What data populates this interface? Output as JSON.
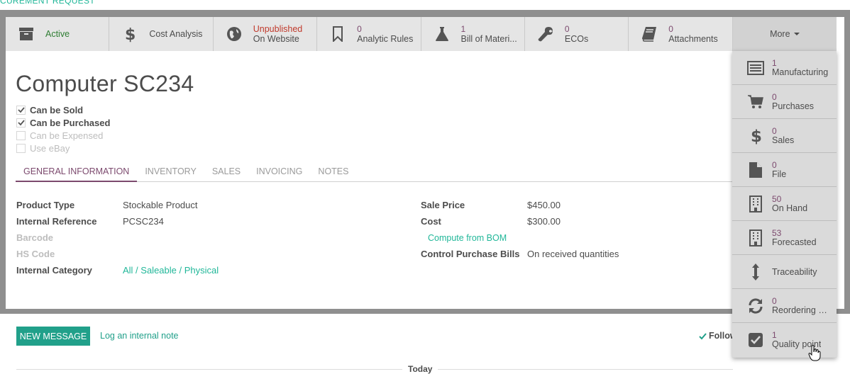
{
  "breadcrumb_fragment": "CUREMENT REQUEST",
  "smart_buttons": [
    {
      "id": "active",
      "icon": "archive-icon",
      "label": "Active"
    },
    {
      "id": "cost-analysis",
      "icon": "dollar-icon",
      "label": "Cost Analysis"
    },
    {
      "id": "website",
      "icon": "globe-icon",
      "top": "Unpublished",
      "label": "On Website"
    },
    {
      "id": "analytic-rules",
      "icon": "bookmark-icon",
      "count": "0",
      "label": "Analytic Rules"
    },
    {
      "id": "bom",
      "icon": "flask-icon",
      "count": "1",
      "label": "Bill of Materi..."
    },
    {
      "id": "ecos",
      "icon": "wrench-icon",
      "count": "0",
      "label": "ECOs"
    },
    {
      "id": "attachments",
      "icon": "book-icon",
      "count": "0",
      "label": "Attachments"
    }
  ],
  "more_label": "More",
  "product": {
    "name": "Computer SC234",
    "options": [
      {
        "label": "Can be Sold",
        "checked": true
      },
      {
        "label": "Can be Purchased",
        "checked": true
      },
      {
        "label": "Can be Expensed",
        "checked": false
      },
      {
        "label": "Use eBay",
        "checked": false
      }
    ]
  },
  "tabs": [
    "GENERAL INFORMATION",
    "INVENTORY",
    "SALES",
    "INVOICING",
    "NOTES"
  ],
  "fields_left": [
    {
      "label": "Product Type",
      "value": "Stockable Product"
    },
    {
      "label": "Internal Reference",
      "value": "PCSC234"
    },
    {
      "label": "Barcode",
      "value": ""
    },
    {
      "label": "HS Code",
      "value": ""
    },
    {
      "label": "Internal Category",
      "value": "All / Saleable / Physical"
    }
  ],
  "fields_right": {
    "sale_price_label": "Sale Price",
    "sale_price": "$450.00",
    "cost_label": "Cost",
    "cost": "$300.00",
    "compute_link": "Compute from BOM",
    "control_label": "Control Purchase Bills",
    "control_value": "On received quantities"
  },
  "chatter": {
    "new_message": "NEW MESSAGE",
    "log_note": "Log an internal note",
    "follow": "Follow",
    "today": "Today"
  },
  "dropdown_items": [
    {
      "icon": "list-icon",
      "count": "1",
      "label": "Manufacturing"
    },
    {
      "icon": "cart-icon",
      "count": "0",
      "label": "Purchases"
    },
    {
      "icon": "dollar-icon",
      "count": "0",
      "label": "Sales"
    },
    {
      "icon": "file-icon",
      "count": "0",
      "label": "File"
    },
    {
      "icon": "building-icon",
      "count": "50",
      "label": "On Hand"
    },
    {
      "icon": "building-icon",
      "count": "53",
      "label": "Forecasted"
    },
    {
      "icon": "vertical-arrows-icon",
      "count": "",
      "label": "Traceability"
    },
    {
      "icon": "refresh-icon",
      "count": "0",
      "label": "Reordering R..."
    },
    {
      "icon": "checkbox-icon",
      "count": "1",
      "label": "Quality point"
    }
  ],
  "colors": {
    "accent": "#7c4a6e",
    "link": "#21b799",
    "primary_button": "#21a08a",
    "frame": "#8f8f8f"
  }
}
